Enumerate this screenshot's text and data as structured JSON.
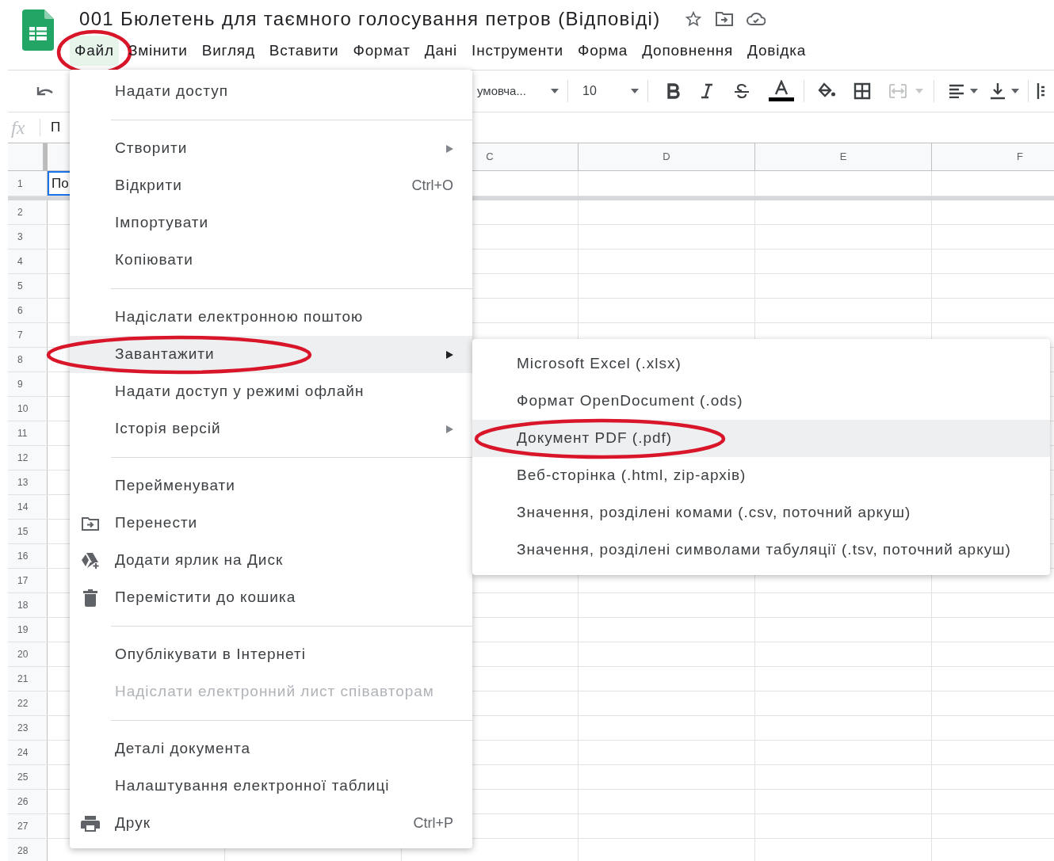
{
  "app": {
    "title": "001 Бюлетень для таємного голосування петров (Відповіді)"
  },
  "menubar": [
    {
      "label": "Файл",
      "selected": true,
      "circled": true
    },
    {
      "label": "Змінити",
      "selected": false,
      "circled": false
    },
    {
      "label": "Вигляд",
      "selected": false,
      "circled": false
    },
    {
      "label": "Вставити",
      "selected": false,
      "circled": false
    },
    {
      "label": "Формат",
      "selected": false,
      "circled": false
    },
    {
      "label": "Дані",
      "selected": false,
      "circled": false
    },
    {
      "label": "Інструменти",
      "selected": false,
      "circled": false
    },
    {
      "label": "Форма",
      "selected": false,
      "circled": false
    },
    {
      "label": "Доповнення",
      "selected": false,
      "circled": false
    },
    {
      "label": "Довідка",
      "selected": false,
      "circled": false
    }
  ],
  "toolbar": {
    "font": "умовча...",
    "font_size": "10"
  },
  "formula_bar": {
    "label": "fx",
    "value": "П"
  },
  "columns": [
    "C",
    "D",
    "E",
    "F"
  ],
  "rows": [
    "1",
    "2",
    "3",
    "4",
    "5",
    "6",
    "7",
    "8",
    "9",
    "10",
    "11",
    "12",
    "13",
    "14",
    "15",
    "16",
    "17",
    "18",
    "19",
    "20",
    "21",
    "22",
    "23",
    "24",
    "25",
    "26",
    "27",
    "28"
  ],
  "active_cell": {
    "value": "По",
    "selected": true
  },
  "file_menu": [
    {
      "kind": "item",
      "label": "Надати доступ",
      "highlighted": false,
      "disabled": false,
      "circled": false
    },
    {
      "kind": "separator"
    },
    {
      "kind": "item",
      "label": "Створити",
      "submenu": true,
      "highlighted": false,
      "disabled": false,
      "circled": false
    },
    {
      "kind": "item",
      "label": "Відкрити",
      "shortcut": "Ctrl+O",
      "highlighted": false,
      "disabled": false,
      "circled": false
    },
    {
      "kind": "item",
      "label": "Імпортувати",
      "highlighted": false,
      "disabled": false,
      "circled": false
    },
    {
      "kind": "item",
      "label": "Копіювати",
      "highlighted": false,
      "disabled": false,
      "circled": false
    },
    {
      "kind": "separator"
    },
    {
      "kind": "item",
      "label": "Надіслати електронною поштою",
      "highlighted": false,
      "disabled": false,
      "circled": false
    },
    {
      "kind": "item",
      "label": "Завантажити",
      "submenu": true,
      "highlighted": true,
      "disabled": false,
      "circled": true
    },
    {
      "kind": "item",
      "label": "Надати доступ у режимі офлайн",
      "highlighted": false,
      "disabled": false,
      "circled": false
    },
    {
      "kind": "item",
      "label": "Історія версій",
      "submenu": true,
      "highlighted": false,
      "disabled": false,
      "circled": false
    },
    {
      "kind": "separator"
    },
    {
      "kind": "item",
      "label": "Перейменувати",
      "highlighted": false,
      "disabled": false,
      "circled": false
    },
    {
      "kind": "item",
      "label": "Перенести",
      "highlighted": false,
      "disabled": false,
      "circled": false
    },
    {
      "kind": "item",
      "label": "Додати ярлик на Диск",
      "highlighted": false,
      "disabled": false,
      "circled": false
    },
    {
      "kind": "item",
      "label": "Перемістити до кошика",
      "highlighted": false,
      "disabled": false,
      "circled": false
    },
    {
      "kind": "separator"
    },
    {
      "kind": "item",
      "label": "Опублікувати в Інтернеті",
      "highlighted": false,
      "disabled": false,
      "circled": false
    },
    {
      "kind": "item",
      "label": "Надіслати електронний лист співавторам",
      "highlighted": false,
      "disabled": true,
      "circled": false
    },
    {
      "kind": "separator"
    },
    {
      "kind": "item",
      "label": "Деталі документа",
      "highlighted": false,
      "disabled": false,
      "circled": false
    },
    {
      "kind": "item",
      "label": "Налаштування електронної таблиці",
      "highlighted": false,
      "disabled": false,
      "circled": false
    },
    {
      "kind": "item",
      "label": "Друк",
      "shortcut": "Ctrl+P",
      "highlighted": false,
      "disabled": false,
      "circled": false
    }
  ],
  "download_menu": [
    {
      "label": "Microsoft Excel (.xlsx)",
      "highlighted": false,
      "circled": false
    },
    {
      "label": "Формат OpenDocument (.ods)",
      "highlighted": false,
      "circled": false
    },
    {
      "label": "Документ PDF (.pdf)",
      "highlighted": true,
      "circled": true
    },
    {
      "label": "Веб-сторінка (.html, zip-архів)",
      "highlighted": false,
      "circled": false
    },
    {
      "label": "Значення, розділені комами (.csv, поточний аркуш)",
      "highlighted": false,
      "circled": false
    },
    {
      "label": "Значення, розділені символами табуляції (.tsv, поточний аркуш)",
      "highlighted": false,
      "circled": false
    }
  ]
}
